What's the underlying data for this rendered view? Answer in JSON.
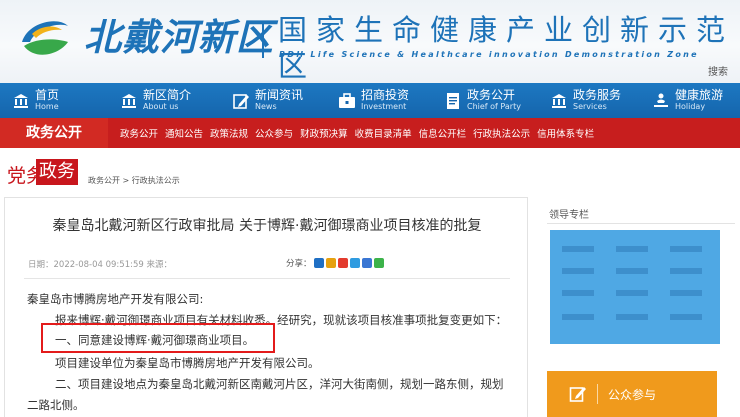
{
  "banner": {
    "logo_text": "北戴河新区",
    "title": "国家生命健康产业创新示范区",
    "subtitle": "BDH Life Science & Healthcare innovation Demonstration Zone",
    "search_label": "搜索"
  },
  "main_nav": [
    {
      "cn": "首页",
      "en": "Home",
      "icon": "bank-icon"
    },
    {
      "cn": "新区简介",
      "en": "About us",
      "icon": "bank-icon"
    },
    {
      "cn": "新闻资讯",
      "en": "News",
      "icon": "edit-icon"
    },
    {
      "cn": "招商投资",
      "en": "Investment",
      "icon": "briefcase-icon"
    },
    {
      "cn": "政务公开",
      "en": "Chief of Party",
      "icon": "document-icon"
    },
    {
      "cn": "政务服务",
      "en": "Services",
      "icon": "bank-icon"
    },
    {
      "cn": "健康旅游",
      "en": "Holiday",
      "icon": "traveler-icon"
    }
  ],
  "sub_nav": {
    "label": "政务公开",
    "links": [
      "政务公开",
      "通知公告",
      "政策法规",
      "公众参与",
      "财政预决算",
      "收费目录清单",
      "信息公开栏",
      "行政执法公示",
      "信用体系专栏"
    ]
  },
  "breadcrumb": {
    "dang": "党务",
    "zheng": "政务",
    "path": "政务公开 > 行政执法公示"
  },
  "article": {
    "title": "秦皇岛北戴河新区行政审批局 关于博辉·戴河御璟商业项目核准的批复",
    "meta": "日期：2022-08-04 09:51:59  来源：",
    "share_label": "分享：",
    "share_colors": [
      "#1f6fc4",
      "#e6a10f",
      "#e33b2e",
      "#2f9be0",
      "#3a76d3",
      "#3cb34a"
    ],
    "paragraphs": [
      "秦皇岛市博腾房地产开发有限公司:",
      "报来博辉·戴河御璟商业项目有关材料收悉。经研究，现就该项目核准事项批复变更如下：",
      "一、同意建设博辉·戴河御璟商业项目。",
      "项目建设单位为秦皇岛市博腾房地产开发有限公司。",
      "二、项目建设地点为秦皇岛北戴河新区南戴河片区，洋河大街南侧，规划一路东侧，规划",
      "二路北侧。"
    ]
  },
  "sidebar": {
    "title": "领导专栏",
    "civic_label": "公众参与"
  },
  "colors": {
    "nav_blue": "#1a6fb8",
    "subnav_red": "#c71e1e",
    "highlight_red": "#e31b1b",
    "civic_orange": "#f09a1c",
    "leader_box_blue": "#4fa8e4"
  }
}
